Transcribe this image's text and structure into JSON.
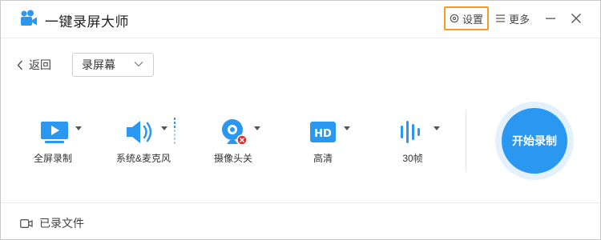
{
  "app": {
    "title": "一键录屏大师"
  },
  "header": {
    "settings_label": "设置",
    "more_label": "更多"
  },
  "nav": {
    "back_label": "返回",
    "mode_value": "录屏幕"
  },
  "options": [
    {
      "label": "全屏录制"
    },
    {
      "label": "系统&麦克风"
    },
    {
      "label": "摄像头关"
    },
    {
      "label": "高清",
      "badge": "HD"
    },
    {
      "label": "30帧"
    }
  ],
  "start": {
    "label": "开始录制"
  },
  "footer": {
    "recorded_label": "已录文件"
  },
  "colors": {
    "accent": "#2a97f0",
    "highlight_border": "#f39a2a",
    "camera_off": "#e02e2e"
  }
}
